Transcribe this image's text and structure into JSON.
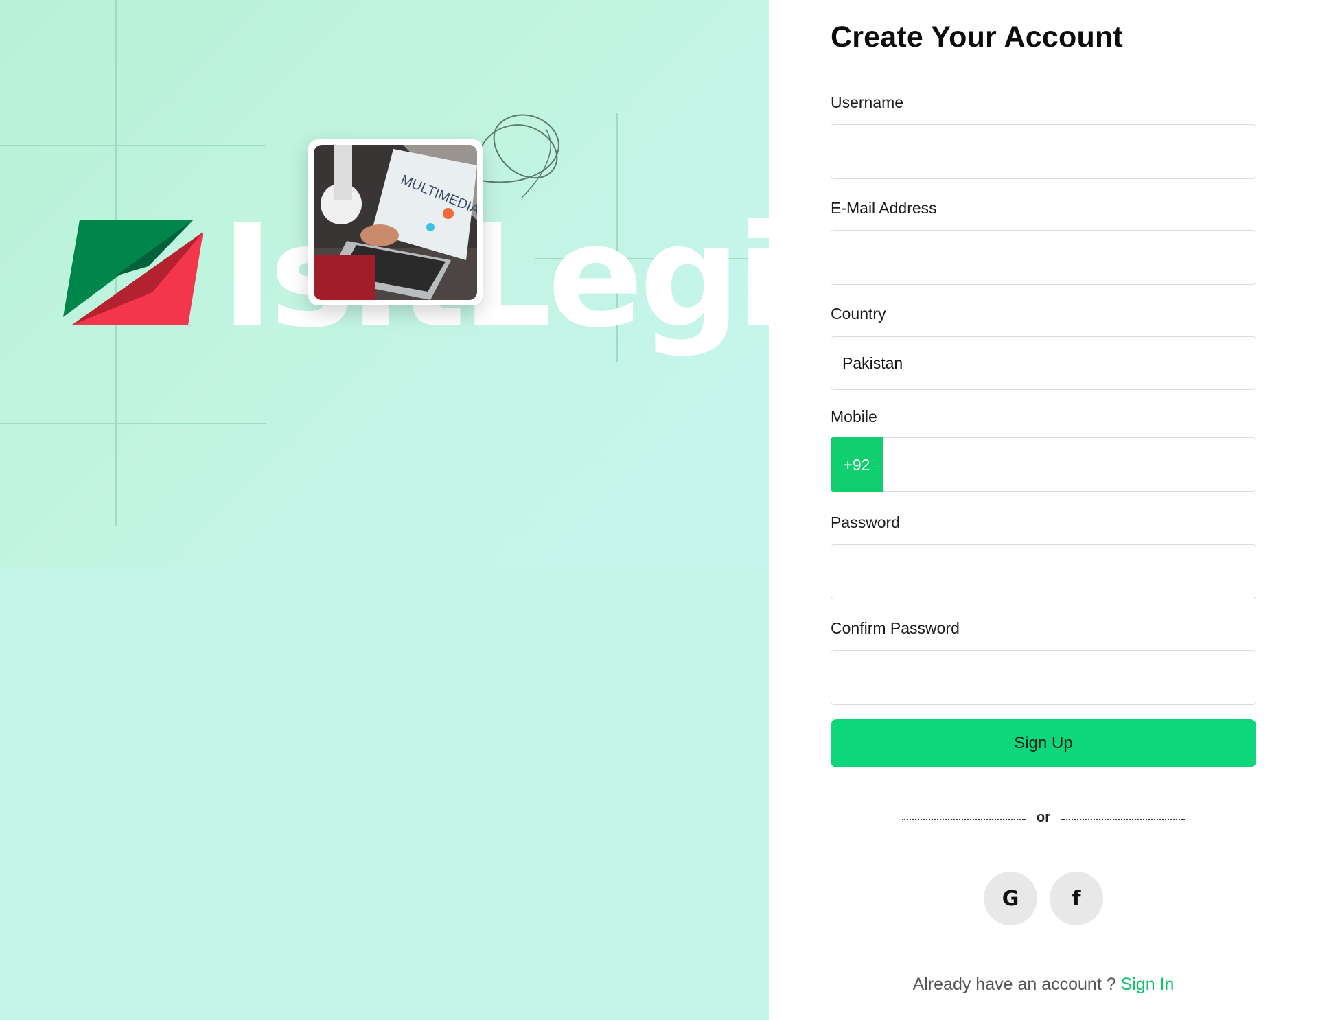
{
  "brand": {
    "wordmark": "IsItLegit",
    "colors": {
      "green": "#00854a",
      "dark_green": "#00613a",
      "red": "#f4364c",
      "dark_red": "#a81e2c"
    }
  },
  "hero": {
    "photo_icon": "laptop-photo",
    "photo_caption": "MULTIMEDIA"
  },
  "form": {
    "title": "Create Your Account",
    "username": {
      "label": "Username",
      "value": "",
      "placeholder": ""
    },
    "email": {
      "label": "E-Mail Address",
      "value": "",
      "placeholder": ""
    },
    "country": {
      "label": "Country",
      "value": "Pakistan"
    },
    "mobile": {
      "label": "Mobile",
      "dial_code": "+92",
      "value": "",
      "placeholder": ""
    },
    "password": {
      "label": "Password",
      "value": "",
      "placeholder": ""
    },
    "confirm_password": {
      "label": "Confirm Password",
      "value": "",
      "placeholder": ""
    },
    "submit_label": "Sign Up",
    "divider_text": "or",
    "social": [
      {
        "name": "google",
        "glyph": "G",
        "icon": "google-icon"
      },
      {
        "name": "facebook",
        "glyph": "f",
        "icon": "facebook-icon"
      }
    ],
    "signin_prompt": "Already have an account ?",
    "signin_link": "Sign In"
  },
  "colors": {
    "accent": "#0dd77a",
    "dial_code_bg": "#0fcf6f",
    "link": "#14c46c",
    "hero_bg": "#c5f4e7"
  }
}
